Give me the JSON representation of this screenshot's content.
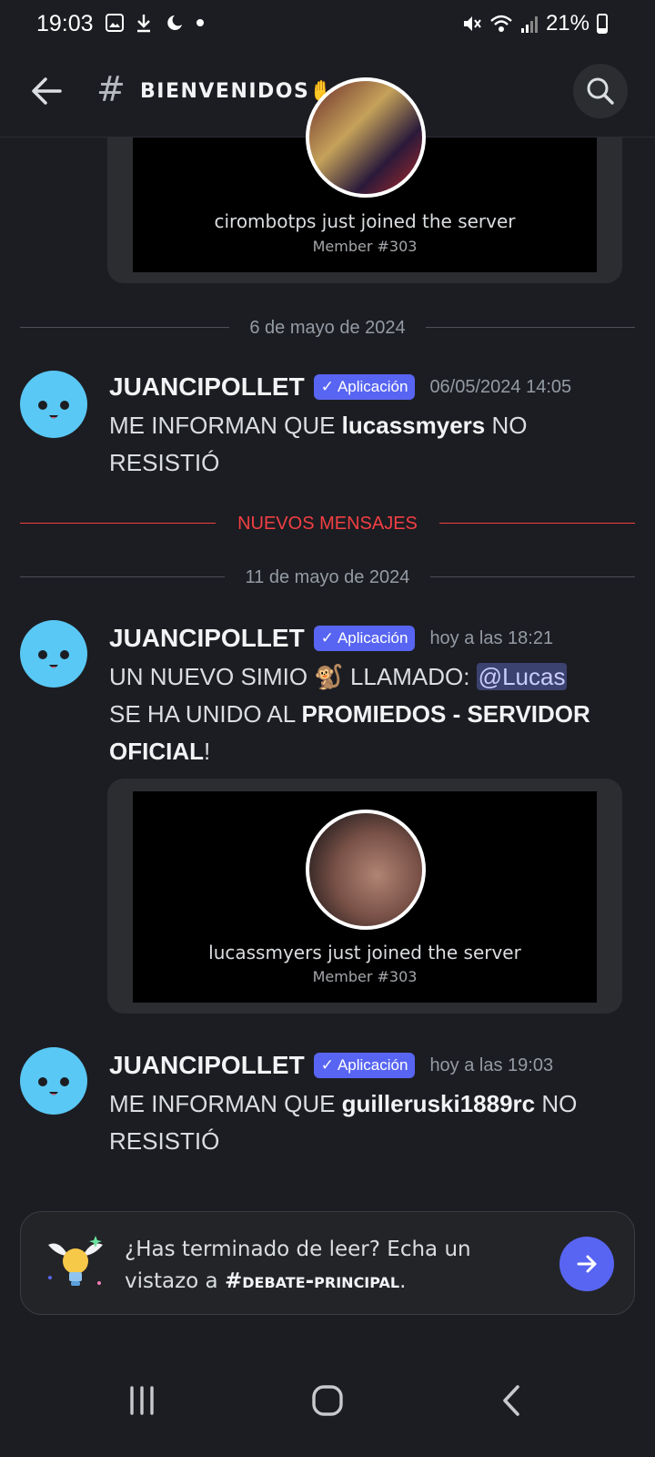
{
  "status": {
    "time": "19:03",
    "battery": "21%"
  },
  "header": {
    "hash": "#",
    "channel": "BIENVENIDOS✋",
    "chevron": "›"
  },
  "embed1": {
    "text": "cirombotps just joined the server",
    "member": "Member #303"
  },
  "divider_may6": "6 de mayo de 2024",
  "msg1": {
    "author": "JUANCIPOLLET",
    "badge": "Aplicación",
    "timestamp": "06/05/2024 14:05",
    "pre": "ME INFORMAN QUE ",
    "user": "lucassmyers",
    "post": " NO RESISTIÓ"
  },
  "new_messages": "NUEVOS MENSAJES",
  "divider_may11": "11 de mayo de 2024",
  "msg2": {
    "author": "JUANCIPOLLET",
    "badge": "Aplicación",
    "timestamp": "hoy a las 18:21",
    "pre": "UN NUEVO SIMIO ",
    "emoji": "🐒",
    "mid": " LLAMADO: ",
    "mention": "@Lucas",
    "line2": " SE HA UNIDO AL  ",
    "server": "PROMIEDOS - SERVIDOR OFICIAL",
    "post": "!"
  },
  "embed2": {
    "text": "lucassmyers just joined the server",
    "member": "Member #303"
  },
  "msg3": {
    "author": "JUANCIPOLLET",
    "badge": "Aplicación",
    "timestamp": "hoy a las 19:03",
    "pre": "ME INFORMAN QUE ",
    "user": "guilleruski1889rc",
    "post": " NO RESISTIÓ"
  },
  "prompt": {
    "text": "¿Has terminado de leer? Echa un vistazo a ",
    "channel": "#debate-principal",
    "end": "."
  },
  "colors": {
    "blurple": "#5865f2",
    "new_red": "#f23f43",
    "avatar": "#5ac8f5",
    "bg": "#1c1d22"
  }
}
